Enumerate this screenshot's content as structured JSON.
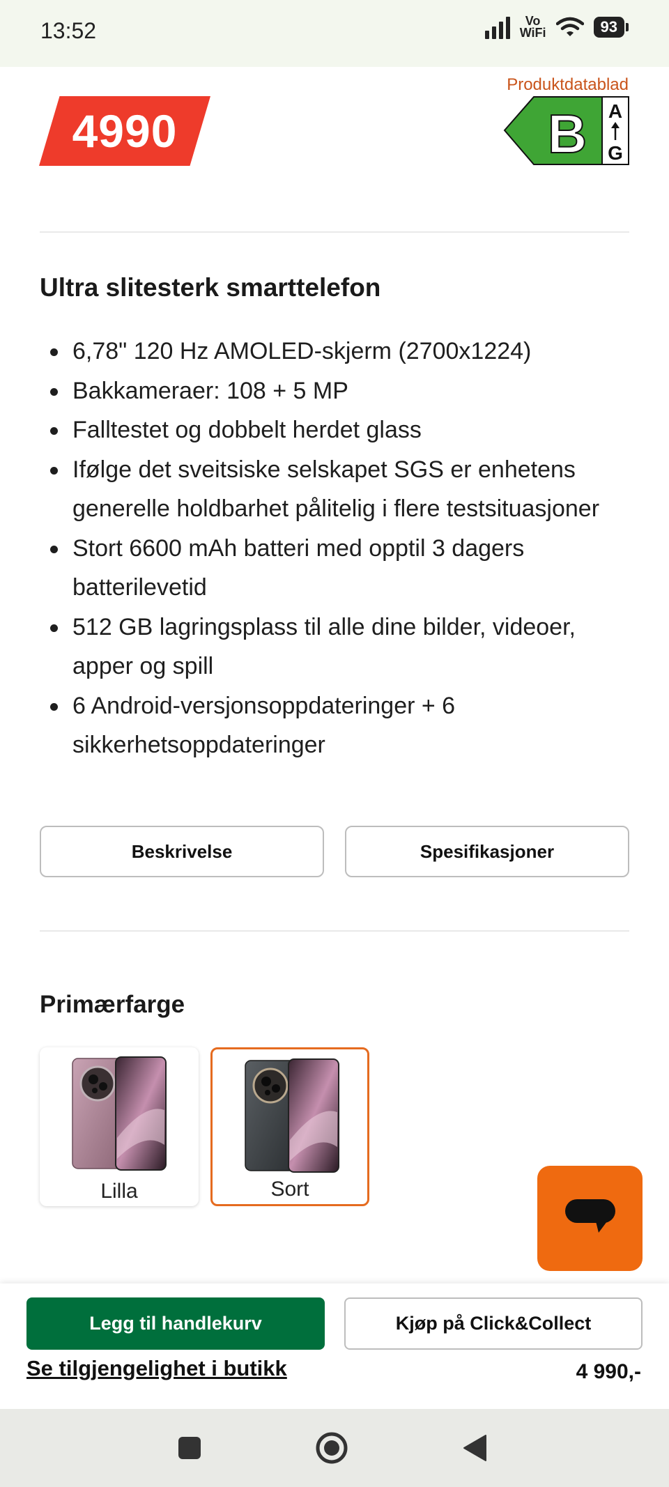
{
  "status_bar": {
    "time": "13:52",
    "network_label_top": "Vo",
    "network_label_bottom": "WiFi",
    "battery": "93",
    "icons": [
      "signal-icon",
      "vowifi-icon",
      "wifi-icon",
      "battery-icon"
    ]
  },
  "product": {
    "price_badge": "4990",
    "datasheet_link": "Produktdatablad",
    "energy_class": "B",
    "energy_scale_top": "A",
    "energy_scale_bottom": "G",
    "energy_color": "#3fa535",
    "price_color": "#ee3b2b"
  },
  "highlights": {
    "title": "Ultra slitesterk smarttelefon",
    "items": [
      "6,78\" 120 Hz AMOLED-skjerm (2700x1224)",
      "Bakkameraer: 108 + 5 MP",
      "Falltestet og dobbelt herdet glass",
      "Ifølge det sveitsiske selskapet SGS er enhetens generelle holdbarhet pålitelig i flere testsituasjoner",
      "Stort 6600 mAh batteri med opptil 3 dagers batterilevetid",
      "512 GB lagringsplass til alle dine bilder, videoer, apper og spill",
      "6 Android-versjonsoppdateringer + 6 sikkerhetsoppdateringer"
    ]
  },
  "buttons": {
    "description": "Beskrivelse",
    "specifications": "Spesifikasjoner"
  },
  "color_picker": {
    "title": "Primærfarge",
    "options": [
      {
        "label": "Lilla",
        "selected": false
      },
      {
        "label": "Sort",
        "selected": true
      }
    ],
    "selected_border_color": "#e56b1f"
  },
  "chat": {
    "icon": "chat-bubble-icon",
    "color": "#ef6a10"
  },
  "purchase_bar": {
    "add_to_cart": "Legg til handlekurv",
    "click_collect": "Kjøp på Click&Collect",
    "availability_link": "Se tilgjengelighet i butikk",
    "price": "4 990,-",
    "cart_color": "#006f3c"
  },
  "nav": {
    "icons": [
      "recents-square-icon",
      "home-circle-icon",
      "back-triangle-icon"
    ]
  }
}
